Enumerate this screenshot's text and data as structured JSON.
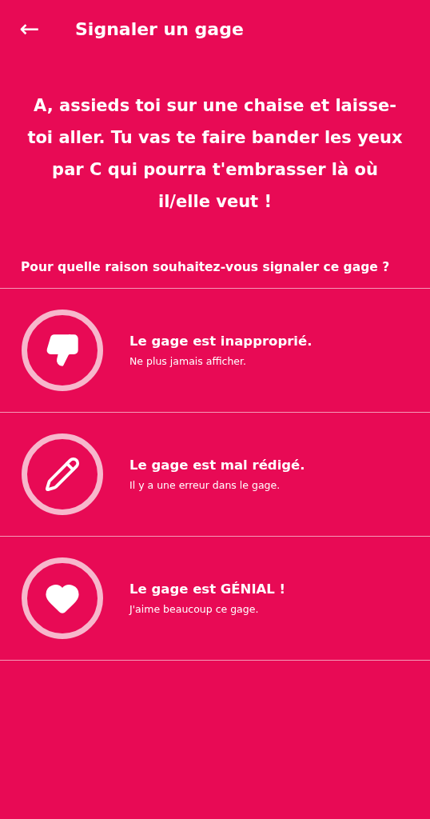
{
  "header": {
    "back": "←",
    "title": "Signaler un gage"
  },
  "dare": "A, assieds toi sur une chaise et laisse-toi aller. Tu vas te faire bander les yeux par C qui pourra t'embrasser là où il/elle veut !",
  "question": "Pour quelle raison souhaitez-vous signaler ce gage ?",
  "options": [
    {
      "kind": "dislike",
      "title": "Le gage est inapproprié.",
      "subtitle": "Ne plus jamais afficher."
    },
    {
      "kind": "edit",
      "title": "Le gage est mal rédigé.",
      "subtitle": "Il y a une erreur dans le gage."
    },
    {
      "kind": "like",
      "title": "Le gage est GÉNIAL !",
      "subtitle": "J'aime beaucoup ce gage."
    }
  ]
}
